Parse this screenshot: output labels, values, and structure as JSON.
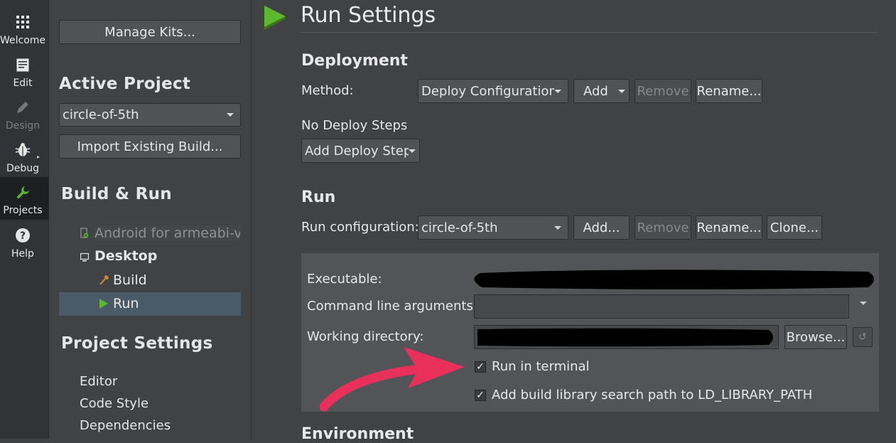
{
  "modes": [
    {
      "label": "Welcome",
      "icon": "grid-icon"
    },
    {
      "label": "Edit",
      "icon": "document-icon"
    },
    {
      "label": "Design",
      "icon": "pencil-icon"
    },
    {
      "label": "Debug",
      "icon": "bug-icon"
    },
    {
      "label": "Projects",
      "icon": "wrench-icon"
    },
    {
      "label": "Help",
      "icon": "question-icon"
    }
  ],
  "nav": {
    "manage_kits": "Manage Kits...",
    "active_project_heading": "Active Project",
    "active_project": "circle-of-5th",
    "import_build": "Import Existing Build...",
    "build_run_heading": "Build & Run",
    "kits": [
      {
        "name": "Android for armeabi-v..."
      },
      {
        "name": "Desktop",
        "children": [
          "Build",
          "Run"
        ]
      }
    ],
    "project_settings_heading": "Project Settings",
    "project_settings": [
      "Editor",
      "Code Style",
      "Dependencies"
    ]
  },
  "main": {
    "title": "Run Settings",
    "deployment": {
      "heading": "Deployment",
      "method_label": "Method:",
      "method_value": "Deploy Configuration",
      "add": "Add",
      "remove": "Remove",
      "rename": "Rename...",
      "no_steps": "No Deploy Steps",
      "add_step": "Add Deploy Step"
    },
    "run": {
      "heading": "Run",
      "config_label": "Run configuration:",
      "config_value": "circle-of-5th",
      "add": "Add...",
      "remove": "Remove",
      "rename": "Rename...",
      "clone": "Clone...",
      "executable_label": "Executable:",
      "args_label": "Command line arguments:",
      "args_value": "",
      "workdir_label": "Working directory:",
      "browse": "Browse...",
      "run_in_terminal": "Run in terminal",
      "run_in_terminal_checked": true,
      "add_library_path": "Add build library search path to LD_LIBRARY_PATH",
      "add_library_path_checked": true
    },
    "environment_heading": "Environment"
  },
  "colors": {
    "accent_arrow": "#e8305a",
    "run_green": "#5cb82f",
    "selection": "#4a5a66"
  }
}
